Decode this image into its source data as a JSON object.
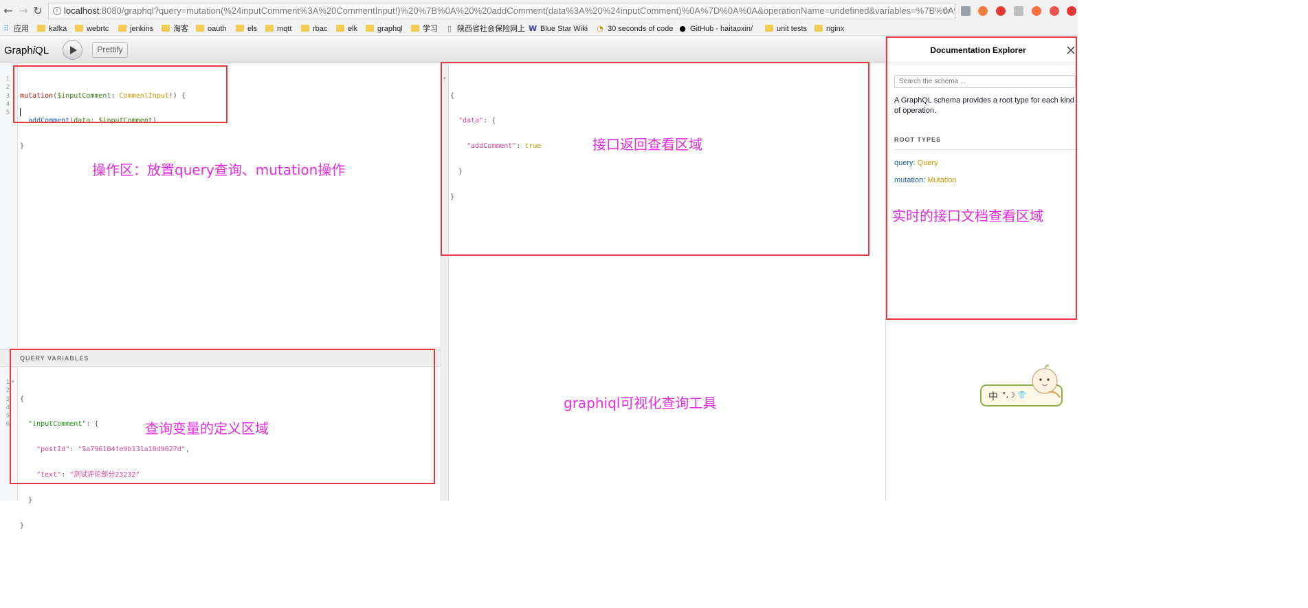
{
  "browser": {
    "url_host": "localhost",
    "url_rest": ":8080/graphql?query=mutation(%24inputComment%3A%20CommentInput!)%20%7B%0A%20%20addComment(data%3A%20%24inputComment)%0A%7D%0A%0A&operationName=undefined&variables=%7B%0A%2...",
    "bookmarks": [
      "应用",
      "kafka",
      "webrtc",
      "jenkins",
      "淘客",
      "oauth",
      "els",
      "mqtt",
      "rbac",
      "elk",
      "graphql",
      "学习",
      "陕西省社会保险网上",
      "Blue Star Wiki",
      "30 seconds of code",
      "GitHub - haitaoxin/",
      "unit tests",
      "nginx"
    ],
    "colors": {
      "folder": "#f4cb52",
      "chrome_bg": "#f2f2f2"
    }
  },
  "graphiql": {
    "logo_pre": "Graph",
    "logo_i": "i",
    "logo_post": "QL",
    "prettify_label": "Prettify",
    "query": {
      "line_numbers": [
        "1",
        "2",
        "3",
        "4",
        "5"
      ],
      "l1_kw": "mutation",
      "l1_a": "(",
      "l1_var": "$inputComment",
      "l1_b": ": ",
      "l1_type": "CommentInput",
      "l1_c": "!) {",
      "l2_def": "  addComment",
      "l2_a": "(",
      "l2_arg": "data",
      "l2_b": ": ",
      "l2_var": "$inputComment",
      "l2_c": ")",
      "l3": "}"
    },
    "result": {
      "l1": "{",
      "l2_key": "  \"data\"",
      "l2_rest": ": {",
      "l3_key": "    \"addComment\"",
      "l3_colon": ": ",
      "l3_val": "true",
      "l4": "  }",
      "l5": "}"
    },
    "variables": {
      "header": "QUERY VARIABLES",
      "line_numbers": [
        "1",
        "2",
        "3",
        "4",
        "5",
        "6"
      ],
      "l1": "{",
      "l2_key": "  \"inputComment\"",
      "l2_rest": ": {",
      "l3_key": "    \"postId\"",
      "l3_colon": ": ",
      "l3_val": "\"5a796104fe9b131a10d9627d\"",
      "l3_comma": ",",
      "l4_key": "    \"text\"",
      "l4_colon": ": ",
      "l4_val": "\"测试评论部分23232\"",
      "l5": "  }",
      "l6": "}"
    },
    "docs": {
      "title": "Documentation Explorer",
      "search_placeholder": "Search the schema ...",
      "description": "A GraphQL schema provides a root type for each kind of operation.",
      "root_types_title": "ROOT TYPES",
      "query_label": "query",
      "query_type": "Query",
      "mutation_label": "mutation",
      "mutation_type": "Mutation"
    },
    "colors": {
      "keyword": "#b11a04",
      "variable": "#397d13",
      "type": "#ca9800",
      "string": "#d64292"
    }
  },
  "annotations": {
    "operation_area": "操作区：放置query查询、mutation操作",
    "response_area": "接口返回查看区域",
    "docs_area": "实时的接口文档查看区域",
    "tool_caption": "graphiql可视化查询工具",
    "variables_area": "查询变量的定义区域",
    "colors": {
      "text": "#e42ce1",
      "box": "#e8373e"
    }
  },
  "ime": {
    "label": "中",
    "glyphs": "°,☽ 👕"
  }
}
